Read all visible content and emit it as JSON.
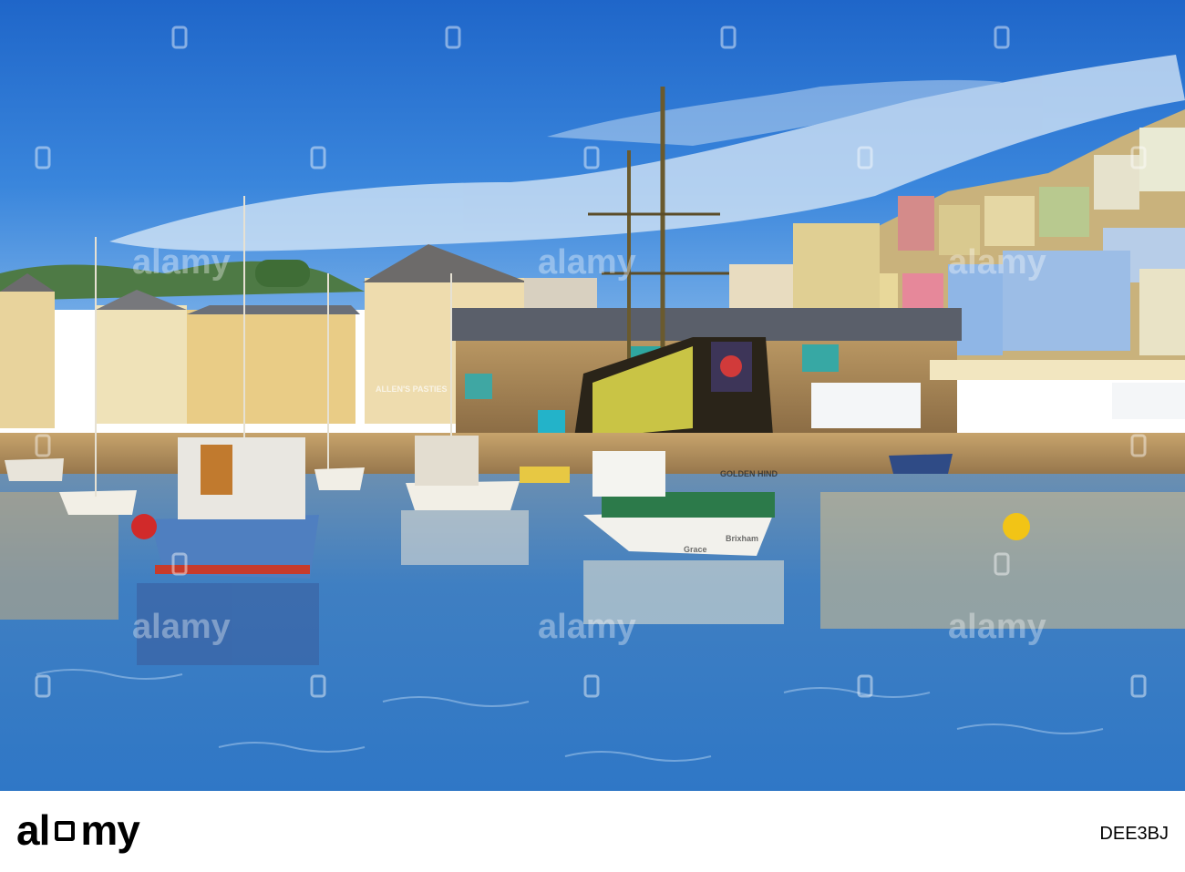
{
  "scene": {
    "description_tags": [
      "harbour",
      "boats",
      "galleon-replica",
      "waterfront-buildings",
      "reflections"
    ],
    "boat_labels": {
      "galleon_name": "GOLDEN HIND",
      "boat_name": "Grace",
      "boat_port": "Brixham",
      "shop_sign": "ALLEN'S PASTIES"
    },
    "colors": {
      "sky": "#2b78d6",
      "water": "#3d7fc1",
      "stone": "#b39265",
      "galleon_hull": "#2a2419"
    }
  },
  "footer": {
    "logo_text_left": "al",
    "logo_text_right": "my",
    "stock_id": "DEE3BJ"
  },
  "watermark": {
    "brand_text": "alamy",
    "pattern": "alamy-watermark-icon"
  }
}
